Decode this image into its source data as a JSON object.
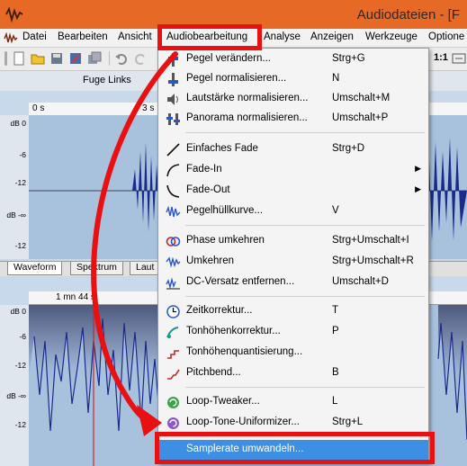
{
  "window": {
    "title": "Audiodateien - [F"
  },
  "menubar": {
    "items": [
      "Datei",
      "Bearbeiten",
      "Ansicht",
      "Audiobearbeitung",
      "Analyse",
      "Anzeigen",
      "Werkzeuge",
      "Optione"
    ]
  },
  "toolbar": {
    "zoom_label": "1:1"
  },
  "track_header": {
    "label": "Fuge Links"
  },
  "panel_top": {
    "ruler": [
      "0 s",
      "3 s"
    ],
    "db_labels": [
      "dB 0",
      "-6",
      "-12",
      "dB -∞",
      "-12",
      "-6",
      "dB 0"
    ],
    "tabs": [
      "Waveform",
      "Spektrum",
      "Laut"
    ]
  },
  "panel_bottom": {
    "ruler": [
      "1 mn 44 s"
    ],
    "db_labels": [
      "dB 0",
      "-6",
      "-12",
      "dB -∞",
      "-12"
    ]
  },
  "dropdown": {
    "items": [
      {
        "icon": "level-change-icon",
        "label": "Pegel verändern...",
        "shortcut": "Strg+G"
      },
      {
        "icon": "normalize-level-icon",
        "label": "Pegel normalisieren...",
        "shortcut": "N"
      },
      {
        "icon": "normalize-volume-icon",
        "label": "Lautstärke normalisieren...",
        "shortcut": "Umschalt+M"
      },
      {
        "icon": "normalize-pan-icon",
        "label": "Panorama normalisieren...",
        "shortcut": "Umschalt+P"
      },
      {
        "icon": "simple-fade-icon",
        "label": "Einfaches Fade",
        "shortcut": "Strg+D"
      },
      {
        "icon": "fade-in-icon",
        "label": "Fade-In",
        "shortcut": "",
        "submenu": true
      },
      {
        "icon": "fade-out-icon",
        "label": "Fade-Out",
        "shortcut": "",
        "submenu": true
      },
      {
        "icon": "envelope-icon",
        "label": "Pegelhüllkurve...",
        "shortcut": "V"
      },
      {
        "icon": "phase-invert-icon",
        "label": "Phase umkehren",
        "shortcut": "Strg+Umschalt+I"
      },
      {
        "icon": "reverse-icon",
        "label": "Umkehren",
        "shortcut": "Strg+Umschalt+R"
      },
      {
        "icon": "dc-offset-icon",
        "label": "DC-Versatz entfernen...",
        "shortcut": "Umschalt+D"
      },
      {
        "icon": "time-correction-icon",
        "label": "Zeitkorrektur...",
        "shortcut": "T"
      },
      {
        "icon": "pitch-correction-icon",
        "label": "Tonhöhenkorrektur...",
        "shortcut": "P"
      },
      {
        "icon": "pitch-quantize-icon",
        "label": "Tonhöhenquantisierung...",
        "shortcut": ""
      },
      {
        "icon": "pitchbend-icon",
        "label": "Pitchbend...",
        "shortcut": "B"
      },
      {
        "icon": "loop-tweaker-icon",
        "label": "Loop-Tweaker...",
        "shortcut": "L"
      },
      {
        "icon": "loop-tone-icon",
        "label": "Loop-Tone-Uniformizer...",
        "shortcut": "Strg+L"
      },
      {
        "icon": "",
        "label": "Samplerate umwandeln...",
        "shortcut": "",
        "highlighted": true
      }
    ]
  },
  "colors": {
    "accent_titlebar": "#e66a25",
    "annotation_red": "#e81010",
    "highlight": "#3c8fe3",
    "waveform": "#1b2a8a"
  }
}
